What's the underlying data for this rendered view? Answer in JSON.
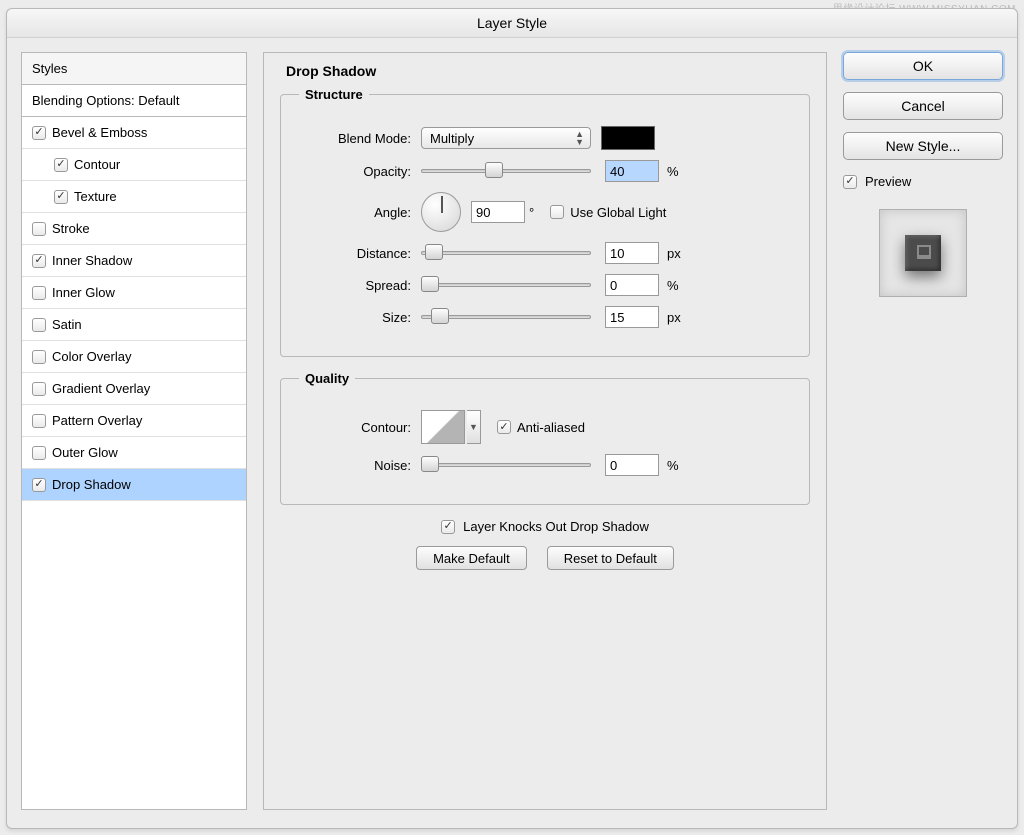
{
  "watermark": "思缘设计论坛  WWW.MISSYUAN.COM",
  "window_title": "Layer Style",
  "sidebar": {
    "header": "Styles",
    "blending": "Blending Options: Default",
    "items": [
      {
        "label": "Bevel & Emboss",
        "checked": true,
        "child": false
      },
      {
        "label": "Contour",
        "checked": true,
        "child": true
      },
      {
        "label": "Texture",
        "checked": true,
        "child": true
      },
      {
        "label": "Stroke",
        "checked": false,
        "child": false
      },
      {
        "label": "Inner Shadow",
        "checked": true,
        "child": false
      },
      {
        "label": "Inner Glow",
        "checked": false,
        "child": false
      },
      {
        "label": "Satin",
        "checked": false,
        "child": false
      },
      {
        "label": "Color Overlay",
        "checked": false,
        "child": false
      },
      {
        "label": "Gradient Overlay",
        "checked": false,
        "child": false
      },
      {
        "label": "Pattern Overlay",
        "checked": false,
        "child": false
      },
      {
        "label": "Outer Glow",
        "checked": false,
        "child": false
      },
      {
        "label": "Drop Shadow",
        "checked": true,
        "child": false,
        "selected": true
      }
    ]
  },
  "panel": {
    "title": "Drop Shadow",
    "structure": {
      "legend": "Structure",
      "blend_mode_label": "Blend Mode:",
      "blend_mode": "Multiply",
      "color": "#000000",
      "opacity_label": "Opacity:",
      "opacity": "40",
      "opacity_unit": "%",
      "angle_label": "Angle:",
      "angle": "90",
      "angle_unit": "°",
      "global_light_label": "Use Global Light",
      "global_light_checked": false,
      "distance_label": "Distance:",
      "distance": "10",
      "distance_unit": "px",
      "spread_label": "Spread:",
      "spread": "0",
      "spread_unit": "%",
      "size_label": "Size:",
      "size": "15",
      "size_unit": "px"
    },
    "quality": {
      "legend": "Quality",
      "contour_label": "Contour:",
      "antialiased_label": "Anti-aliased",
      "antialiased_checked": true,
      "noise_label": "Noise:",
      "noise": "0",
      "noise_unit": "%"
    },
    "knockout_label": "Layer Knocks Out Drop Shadow",
    "knockout_checked": true,
    "make_default": "Make Default",
    "reset_default": "Reset to Default"
  },
  "buttons": {
    "ok": "OK",
    "cancel": "Cancel",
    "new_style": "New Style...",
    "preview": "Preview",
    "preview_checked": true
  }
}
